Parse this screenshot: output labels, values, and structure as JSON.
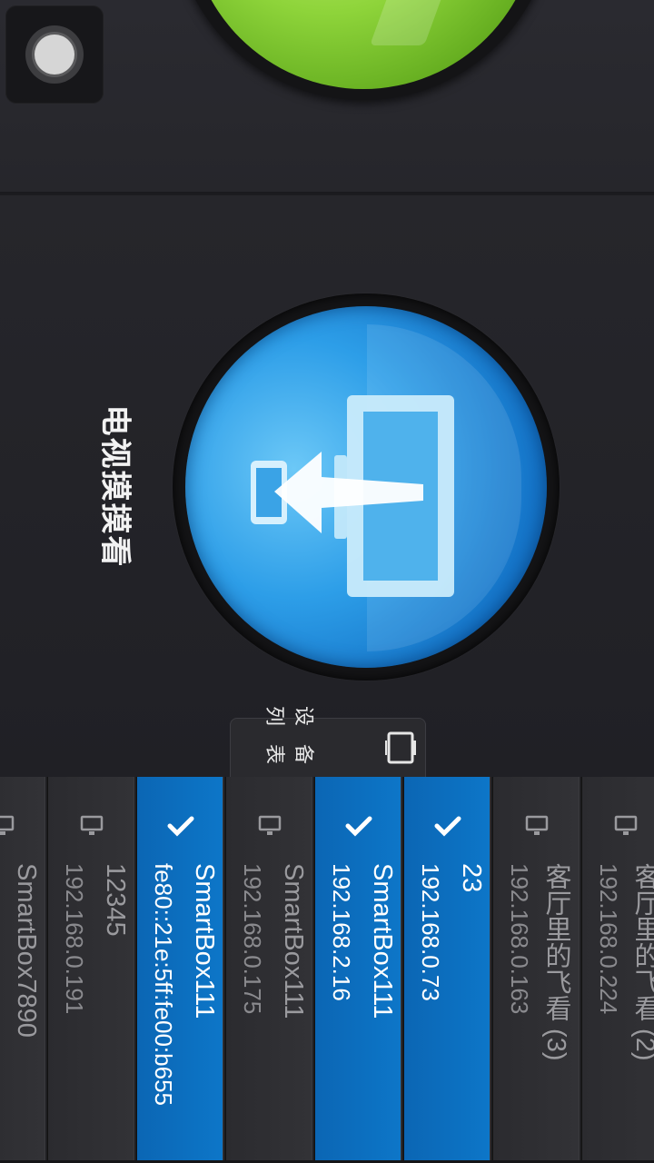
{
  "feature": {
    "label": "电视摸摸看"
  },
  "device_list_tab": {
    "label": "设备列表",
    "icon": "tv-list-icon"
  },
  "devices": [
    {
      "name": "客厅里的飞看 (2)",
      "ip": "192.168.0.224",
      "selected": false
    },
    {
      "name": "客厅里的飞看 (3)",
      "ip": "192.168.0.163",
      "selected": false
    },
    {
      "name": "23",
      "ip": "192.168.0.73",
      "selected": true
    },
    {
      "name": "SmartBox111",
      "ip": "192.168.2.16",
      "selected": true
    },
    {
      "name": "SmartBox111",
      "ip": "192.168.0.175",
      "selected": false
    },
    {
      "name": "SmartBox111",
      "ip": "fe80::21e:5ff:fe00:b655",
      "selected": true
    },
    {
      "name": "12345",
      "ip": "192.168.0.191",
      "selected": false
    },
    {
      "name": "SmartBox7890",
      "ip": "",
      "selected": false
    }
  ],
  "colors": {
    "selected_bg": "#0d76c8",
    "unselected_bg": "#2f2f33",
    "background": "#1c1c20"
  }
}
